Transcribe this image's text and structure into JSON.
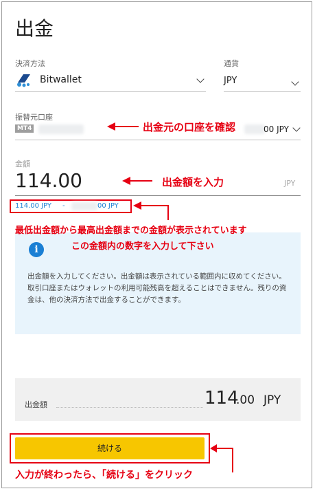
{
  "title": "出金",
  "payment": {
    "label": "決済方法",
    "value": "Bitwallet"
  },
  "currency": {
    "label": "通貨",
    "value": "JPY"
  },
  "account": {
    "label": "振替元口座",
    "tag": "MT4",
    "balance_suffix": "00 JPY"
  },
  "amount": {
    "label": "金額",
    "value": "114.00",
    "unit": "JPY"
  },
  "range": {
    "min": "114.00 JPY",
    "separator": "-",
    "max_suffix": "00 JPY"
  },
  "info": {
    "text": "出金額を入力してください。出金額は表示されている範囲内に収めてください。取引口座またはウォレットの利用可能残高を超えることはできません。残りの資金は、他の決済方法で出金することができます。"
  },
  "summary": {
    "label": "出金額",
    "int": "114",
    "dec": ".00",
    "unit": "JPY"
  },
  "continue_label": "続ける",
  "annotations": {
    "account": "出金元の口座を確認",
    "amount": "出金額を入力",
    "range_line1": "最低出金額から最高出金額までの金額が表示されています",
    "range_line2": "この金額内の数字を入力して下さい",
    "continue": "入力が終わったら、「続ける」をクリック"
  },
  "colors": {
    "accent_blue": "#1a7fd4",
    "yellow_button": "#f7c600",
    "info_bg": "#e8f4fc",
    "annotation_red": "#e60012"
  }
}
